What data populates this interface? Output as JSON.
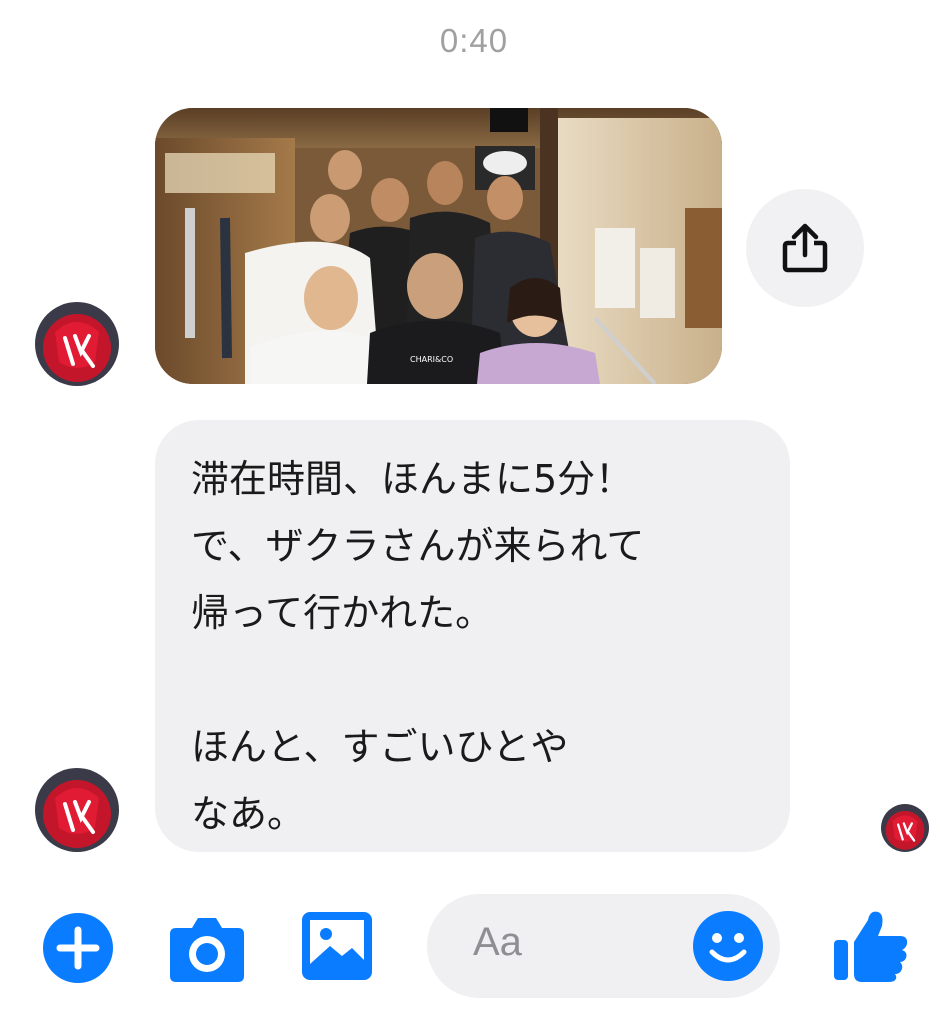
{
  "timestamp": "0:40",
  "thread": {
    "photo": {
      "shirt_text": "CHARI&CO",
      "icon": "group-photo"
    },
    "share_icon": "share-icon",
    "message_lines": [
      "滞在時間、ほんまに5分！",
      "で、ザクラさんが来られて",
      "帰って行かれた。",
      "",
      "ほんと、すごいひとや",
      "なあ。"
    ]
  },
  "composer": {
    "placeholder": "Aa",
    "icons": [
      "plus-icon",
      "camera-icon",
      "image-icon",
      "smiley-icon",
      "thumbs-up-icon"
    ]
  },
  "colors": {
    "accent": "#0a7cff",
    "bubble": "#f0f0f2",
    "text": "#1a1a1a",
    "timestamp": "#a0a0a0"
  }
}
